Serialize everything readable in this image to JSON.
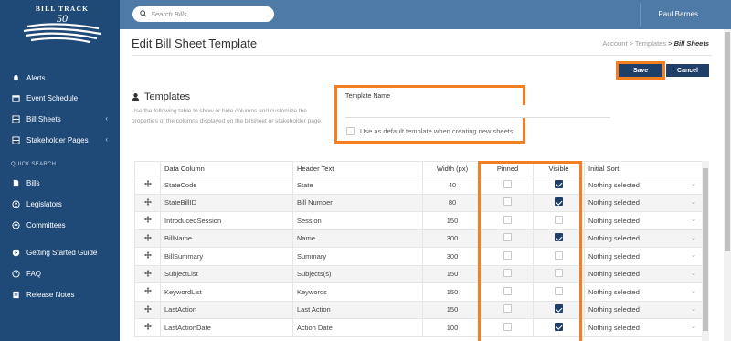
{
  "sidebar": {
    "logo_top": "BILL TRACK",
    "logo_num": "50",
    "nav": [
      {
        "label": "Alerts",
        "icon": "bell-icon"
      },
      {
        "label": "Event Schedule",
        "icon": "calendar-icon"
      },
      {
        "label": "Bill Sheets",
        "icon": "grid-icon"
      },
      {
        "label": "Stakeholder Pages",
        "icon": "grid-icon"
      }
    ],
    "quick_search_label": "QUICK SEARCH",
    "quick": [
      {
        "label": "Bills",
        "icon": "document-icon"
      },
      {
        "label": "Legislators",
        "icon": "person-icon"
      },
      {
        "label": "Committees",
        "icon": "people-icon"
      }
    ],
    "bottom": [
      {
        "label": "Getting Started Guide",
        "icon": "rocket-icon"
      },
      {
        "label": "FAQ",
        "icon": "question-icon"
      },
      {
        "label": "Release Notes",
        "icon": "notes-icon"
      }
    ]
  },
  "topbar": {
    "search_placeholder": "Search Bills",
    "user_name": "Paul Barnes"
  },
  "page": {
    "title": "Edit Bill Sheet Template",
    "breadcrumb": [
      "Account",
      "Templates",
      "Bill Sheets"
    ],
    "save_label": "Save",
    "cancel_label": "Cancel"
  },
  "templates": {
    "title": "Templates",
    "description": "Use the following table to show or hide columns and customize the properties of the columns displayed on the billsheet or stakeholder page.",
    "name_label": "Template Name",
    "name_value": "",
    "default_label": "Use as default template when creating new sheets."
  },
  "table": {
    "headers": [
      "Data Column",
      "Header Text",
      "Width (px)",
      "Pinned",
      "Visible",
      "Initial Sort"
    ],
    "rows": [
      {
        "column": "StateCode",
        "header": "State",
        "width": "40",
        "pinned": false,
        "visible": true,
        "sort": "Nothing selected"
      },
      {
        "column": "StateBillID",
        "header": "Bill Number",
        "width": "80",
        "pinned": false,
        "visible": true,
        "sort": "Nothing selected"
      },
      {
        "column": "IntroducedSession",
        "header": "Session",
        "width": "150",
        "pinned": false,
        "visible": false,
        "sort": "Nothing selected"
      },
      {
        "column": "BillName",
        "header": "Name",
        "width": "300",
        "pinned": false,
        "visible": true,
        "sort": "Nothing selected"
      },
      {
        "column": "BillSummary",
        "header": "Summary",
        "width": "300",
        "pinned": false,
        "visible": false,
        "sort": "Nothing selected"
      },
      {
        "column": "SubjectList",
        "header": "Subjects(s)",
        "width": "150",
        "pinned": false,
        "visible": false,
        "sort": "Nothing selected"
      },
      {
        "column": "KeywordList",
        "header": "Keywords",
        "width": "150",
        "pinned": false,
        "visible": false,
        "sort": "Nothing selected"
      },
      {
        "column": "LastAction",
        "header": "Last Action",
        "width": "150",
        "pinned": false,
        "visible": true,
        "sort": "Nothing selected"
      },
      {
        "column": "LastActionDate",
        "header": "Action Date",
        "width": "100",
        "pinned": false,
        "visible": true,
        "sort": "Nothing selected"
      }
    ]
  },
  "colors": {
    "sidebar": "#1f4a78",
    "topbar": "#4d7aa6",
    "button": "#1f3f69",
    "highlight": "#f47f20"
  }
}
